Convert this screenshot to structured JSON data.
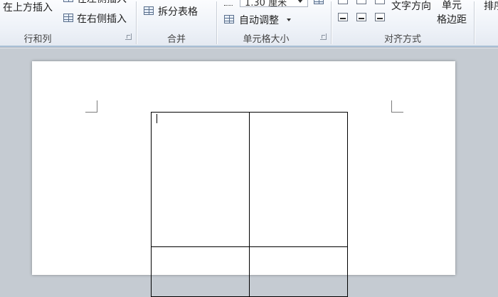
{
  "ribbon": {
    "rows_cols": {
      "insert_above": "在上方插入",
      "insert_left": "在左侧插入",
      "insert_right": "在右侧插入",
      "group_label": "行和列"
    },
    "merge": {
      "split_table": "拆分表格",
      "group_label": "合并"
    },
    "cell_size": {
      "height_value": "1.30 厘米",
      "autofit": "自动调整",
      "group_label": "单元格大小"
    },
    "alignment": {
      "text_direction": "文字方向",
      "cell_margins_line1": "单元",
      "cell_margins_line2": "格边距",
      "group_label": "对齐方式"
    },
    "sort_partial": "排序"
  },
  "colors": {
    "ribbon_bg": "#eef2f8",
    "workspace_bg": "#c5cbd2",
    "page_bg": "#ffffff",
    "table_border": "#000000"
  },
  "document": {
    "table": {
      "rows": 2,
      "cols": 2
    }
  }
}
